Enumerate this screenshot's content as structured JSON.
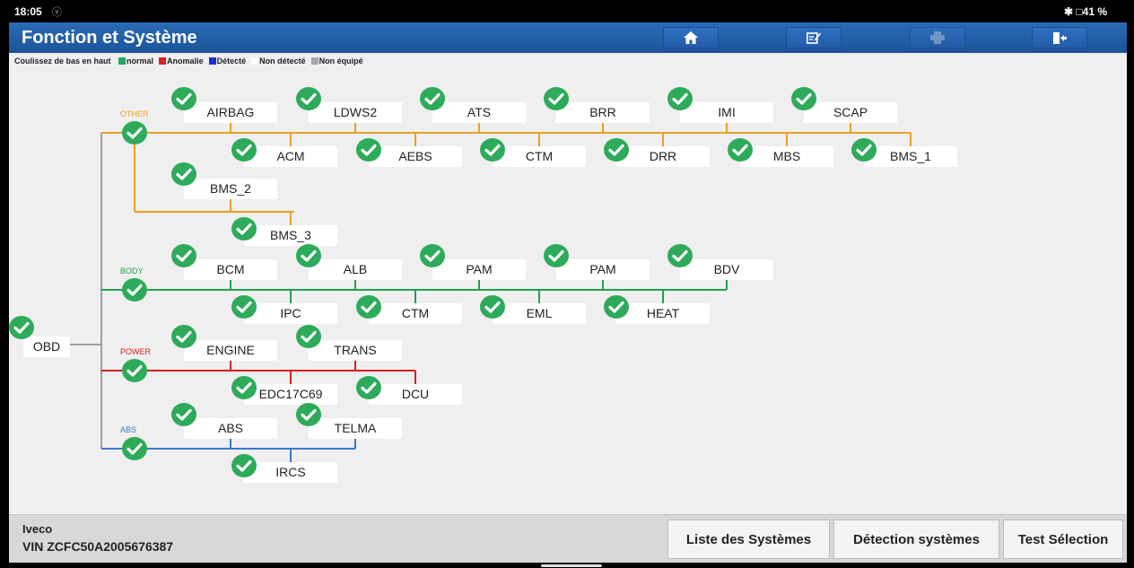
{
  "status_bar": {
    "time": "18:05",
    "signal_glyph": "ⓥ",
    "bluetooth_icon": "bluetooth-icon",
    "battery": "41 %"
  },
  "header": {
    "title": "Fonction et Système",
    "buttons": [
      {
        "name": "home-button",
        "icon": "home-icon"
      },
      {
        "name": "edit-button",
        "icon": "edit-icon"
      },
      {
        "name": "print-button",
        "icon": "print-icon",
        "disabled": true
      },
      {
        "name": "exit-button",
        "icon": "exit-icon"
      }
    ]
  },
  "legend": {
    "hint": "Coulissez de bas en haut",
    "items": [
      {
        "label": "normal",
        "color": "#22a85a"
      },
      {
        "label": "Anomalie",
        "color": "#e02020"
      },
      {
        "label": "Détecté",
        "color": "#1a2fd8"
      },
      {
        "label": "Non détecté",
        "color": "#ffffff"
      },
      {
        "label": "Non équipé",
        "color": "#a8a8a8"
      }
    ]
  },
  "colors": {
    "check": "#2eab5a",
    "root_line": "#a0a0a0"
  },
  "topology": {
    "root": {
      "label": "OBD",
      "status": "normal"
    },
    "groups": [
      {
        "label": "OTHER",
        "color": "#e8a020",
        "upper": [
          "AIRBAG",
          "LDWS2",
          "ATS",
          "BRR",
          "IMI",
          "SCAP"
        ],
        "lower": [
          "ACM",
          "AEBS",
          "CTM",
          "DRR",
          "MBS",
          "BMS_1"
        ],
        "extra": [
          "BMS_2",
          "BMS_3"
        ]
      },
      {
        "label": "BODY",
        "color": "#22a050",
        "upper": [
          "BCM",
          "ALB",
          "PAM",
          "PAM",
          "BDV"
        ],
        "lower": [
          "IPC",
          "CTM",
          "EML",
          "HEAT"
        ]
      },
      {
        "label": "POWER",
        "color": "#d42020",
        "upper": [
          "ENGINE",
          "TRANS"
        ],
        "lower": [
          "EDC17C69",
          "DCU"
        ]
      },
      {
        "label": "ABS",
        "color": "#3a78c8",
        "upper": [
          "ABS",
          "TELMA"
        ],
        "lower": [
          "IRCS"
        ]
      }
    ]
  },
  "footer": {
    "make": "Iveco",
    "vin": "VIN ZCFC50A2005676387",
    "buttons": [
      "Liste des Systèmes",
      "Détection systèmes",
      "Test Sélection"
    ]
  }
}
